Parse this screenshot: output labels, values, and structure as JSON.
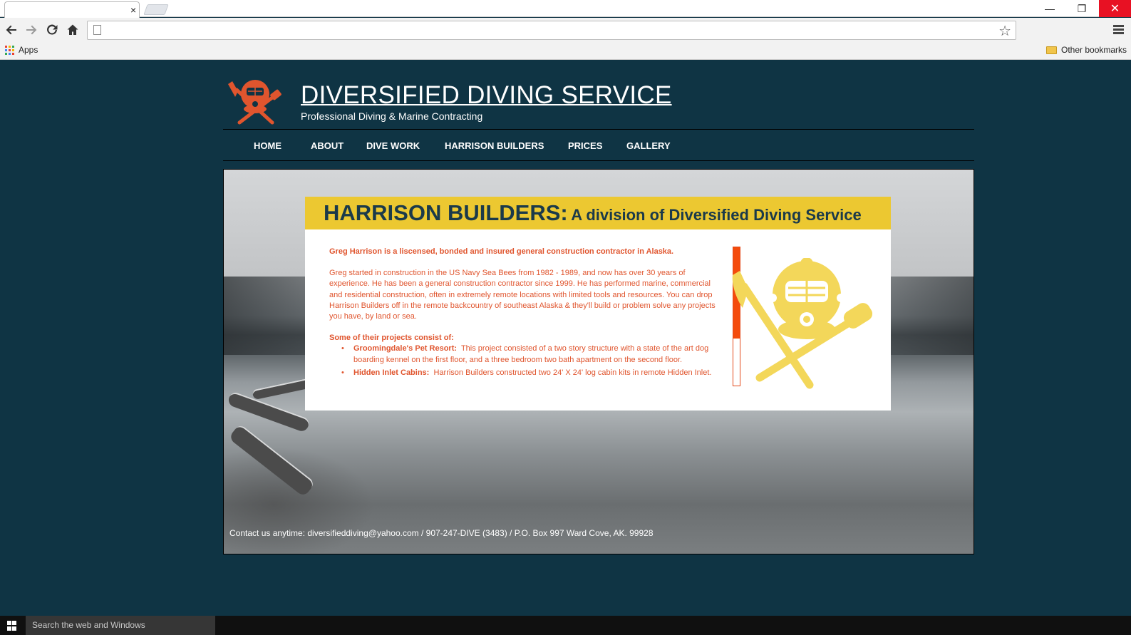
{
  "browser": {
    "tab_close": "×",
    "window_controls": {
      "minimize": "—",
      "restore": "❐",
      "close": "✕"
    },
    "omnibox_value": "",
    "bookmarks_bar": {
      "apps_label": "Apps",
      "other_bookmarks": "Other bookmarks"
    },
    "icons": [
      "back-icon",
      "forward-icon",
      "reload-icon",
      "home-icon",
      "page-icon",
      "star-icon",
      "menu-icon",
      "apps-grid-icon",
      "folder-icon"
    ]
  },
  "site": {
    "title": "DIVERSIFIED DIVING SERVICE",
    "subtitle": "Professional Diving & Marine Contracting",
    "nav": [
      "HOME",
      "ABOUT",
      "DIVE WORK",
      "HARRISON BUILDERS",
      "PRICES",
      "GALLERY"
    ]
  },
  "content": {
    "heading_main": "HARRISON BUILDERS:",
    "heading_sub": "A division of Diversified Diving Service",
    "intro": "Greg Harrison is a liscensed, bonded and insured general construction contractor in Alaska.",
    "paragraph": "Greg started in construction in the US Navy Sea Bees from 1982 - 1989, and now has over 30 years of experience.  He has been a general construction contractor since 1999.  He has performed marine, commercial and residential construction, often in extremely remote locations with limited tools and resources.  You can drop Harrison Builders off in the remote backcountry of southeast Alaska & they'll build or problem solve any projects you have, by land or sea.",
    "projects_heading": "Some of their projects consist of:",
    "projects": [
      {
        "name": "Groomingdale's Pet Resort:",
        "desc": "This project consisted of a two story structure with a state of the art dog boarding kennel on the first floor, and a three bedroom two bath apartment on the second floor."
      },
      {
        "name": "Hidden Inlet Cabins:",
        "desc": "Harrison Builders constructed two 24' X 24' log cabin kits in remote Hidden Inlet."
      }
    ],
    "thermometer_level": 0.66,
    "contact": "Contact us anytime: diversifieddiving@yahoo.com  / 907-247-DIVE (3483) / P.O. Box 997 Ward Cove, AK. 99928"
  },
  "colors": {
    "page_bg": "#0f3444",
    "accent_orange": "#e0552e",
    "banner_yellow": "#ecc831",
    "emblem_yellow": "#f3d75a",
    "heading_navy": "#1b3a4a"
  },
  "taskbar": {
    "search_placeholder": "Search the web and Windows"
  }
}
